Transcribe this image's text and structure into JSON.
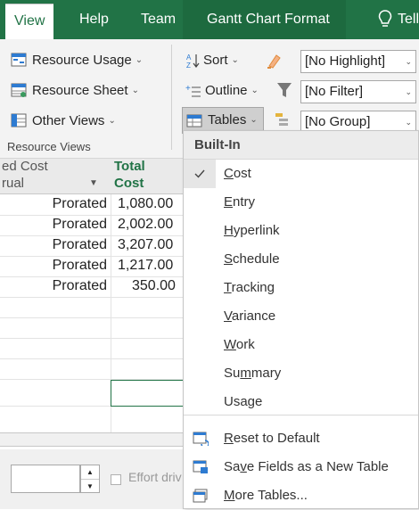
{
  "tabs": [
    {
      "label": "View",
      "active": true
    },
    {
      "label": "Help",
      "active": false
    },
    {
      "label": "Team",
      "active": false
    },
    {
      "label": "Gantt Chart Format",
      "active": false
    },
    {
      "label": "Tell",
      "active": false
    }
  ],
  "ribbon": {
    "resource_usage": "Resource Usage",
    "resource_sheet": "Resource Sheet",
    "other_views": "Other Views",
    "group_label": "Resource Views",
    "sort": "Sort",
    "outline": "Outline",
    "tables": "Tables",
    "highlight_value": "[No Highlight]",
    "filter_value": "[No Filter]",
    "group_value": "[No Group]"
  },
  "sheet": {
    "col_accrual": {
      "line1": "ed Cost",
      "line2": "rual"
    },
    "col_total": {
      "line1": "Total",
      "line2": "Cost"
    },
    "rows": [
      {
        "accrual": "Prorated",
        "cost": "1,080.00"
      },
      {
        "accrual": "Prorated",
        "cost": "2,002.00"
      },
      {
        "accrual": "Prorated",
        "cost": "3,207.00"
      },
      {
        "accrual": "Prorated",
        "cost": "1,217.00"
      },
      {
        "accrual": "Prorated",
        "cost": "350.00"
      }
    ],
    "effort_label": "Effort driv"
  },
  "menu": {
    "header": "Built-In",
    "items": [
      {
        "label": "Cost",
        "checked": true
      },
      {
        "label": "Entry",
        "checked": false
      },
      {
        "label": "Hyperlink",
        "checked": false
      },
      {
        "label": "Schedule",
        "checked": false
      },
      {
        "label": "Tracking",
        "checked": false
      },
      {
        "label": "Variance",
        "checked": false
      },
      {
        "label": "Work",
        "checked": false
      },
      {
        "label": "Summary",
        "checked": false
      },
      {
        "label": "Usage",
        "checked": false
      }
    ],
    "actions": [
      {
        "label": "Reset to Default",
        "icon": "reset-table-icon"
      },
      {
        "label": "Save Fields as a New Table",
        "icon": "save-table-icon"
      },
      {
        "label": "More Tables...",
        "icon": "more-tables-icon"
      }
    ]
  },
  "colors": {
    "accent": "#217346",
    "ribbon_bg": "#f3f3f3"
  }
}
